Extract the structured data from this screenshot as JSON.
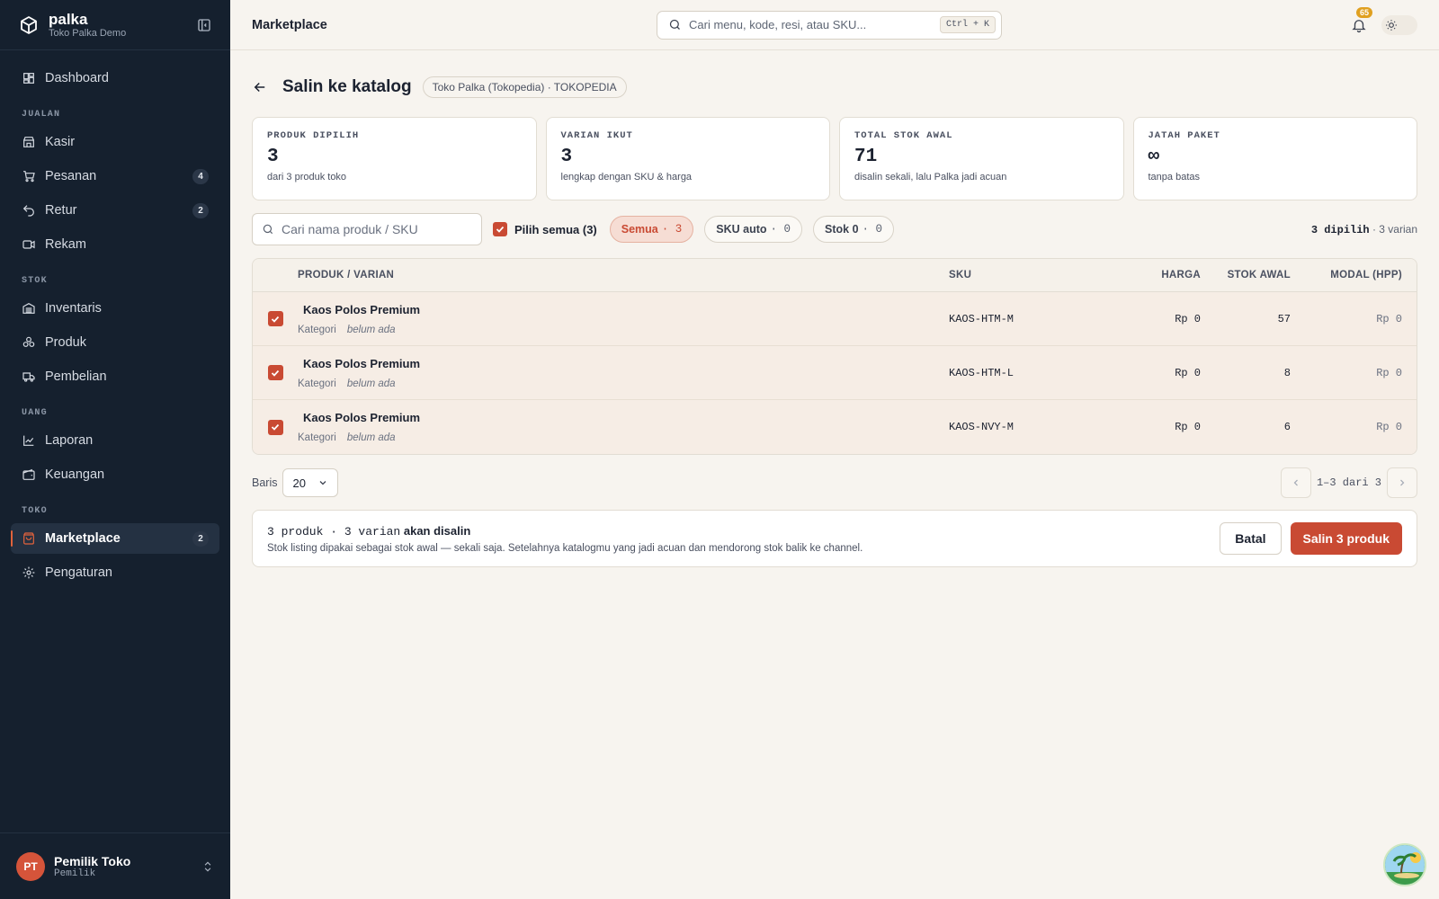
{
  "brand": {
    "name": "palka",
    "store": "Toko Palka Demo"
  },
  "sidebar": {
    "dashboard": "Dashboard",
    "sections": {
      "jualan": "JUALAN",
      "stok": "STOK",
      "uang": "UANG",
      "toko": "TOKO"
    },
    "items": {
      "kasir": "Kasir",
      "pesanan": {
        "label": "Pesanan",
        "count": "4"
      },
      "retur": {
        "label": "Retur",
        "count": "2"
      },
      "rekam": "Rekam",
      "inventaris": "Inventaris",
      "produk": "Produk",
      "pembelian": "Pembelian",
      "laporan": "Laporan",
      "keuangan": "Keuangan",
      "marketplace": {
        "label": "Marketplace",
        "count": "2"
      },
      "pengaturan": "Pengaturan"
    },
    "user": {
      "initials": "PT",
      "name": "Pemilik Toko",
      "role": "Pemilik"
    }
  },
  "topbar": {
    "title": "Marketplace",
    "search_placeholder": "Cari menu, kode, resi, atau SKU...",
    "shortcut": "Ctrl + K",
    "notifications": "65"
  },
  "page": {
    "title": "Salin ke katalog",
    "store_chip": "Toko Palka (Tokopedia) · TOKOPEDIA"
  },
  "stats": [
    {
      "label": "PRODUK DIPILIH",
      "value": "3",
      "sub": "dari 3 produk toko"
    },
    {
      "label": "VARIAN IKUT",
      "value": "3",
      "sub": "lengkap dengan SKU & harga"
    },
    {
      "label": "TOTAL STOK AWAL",
      "value": "71",
      "sub": "disalin sekali, lalu Palka jadi acuan"
    },
    {
      "label": "JATAH PAKET",
      "value": "∞",
      "sub": "tanpa batas"
    }
  ],
  "filters": {
    "search_placeholder": "Cari nama produk / SKU",
    "select_all": "Pilih semua (3)",
    "chips": [
      {
        "label": "Semua",
        "count": "· 3"
      },
      {
        "label": "SKU auto",
        "count": "· 0"
      },
      {
        "label": "Stok 0",
        "count": "· 0"
      }
    ],
    "selected_count": "3 dipilih",
    "selected_variants": "· 3 varian"
  },
  "table": {
    "headers": {
      "product": "PRODUK / VARIAN",
      "sku": "SKU",
      "price": "HARGA",
      "stock": "STOK AWAL",
      "cost": "MODAL (HPP)"
    },
    "category_label": "Kategori",
    "category_value": "belum ada",
    "rows": [
      {
        "name": "Kaos Polos Premium",
        "sku": "KAOS-HTM-M",
        "price": "Rp 0",
        "stock": "57",
        "cost": "Rp 0"
      },
      {
        "name": "Kaos Polos Premium",
        "sku": "KAOS-HTM-L",
        "price": "Rp 0",
        "stock": "8",
        "cost": "Rp 0"
      },
      {
        "name": "Kaos Polos Premium",
        "sku": "KAOS-NVY-M",
        "price": "Rp 0",
        "stock": "6",
        "cost": "Rp 0"
      }
    ]
  },
  "pagination": {
    "rows_label": "Baris",
    "rows_value": "20",
    "range": "1–3 dari 3"
  },
  "action_bar": {
    "summary": "3 produk · 3 varian",
    "summary_suffix": "akan disalin",
    "description": "Stok listing dipakai sebagai stok awal — sekali saja. Setelahnya katalogmu yang jadi acuan dan mendorong stok balik ke channel.",
    "cancel": "Batal",
    "submit": "Salin 3 produk"
  },
  "colors": {
    "accent": "#c94a33",
    "sidebar": "#15202e",
    "background": "#f7f4ef"
  }
}
